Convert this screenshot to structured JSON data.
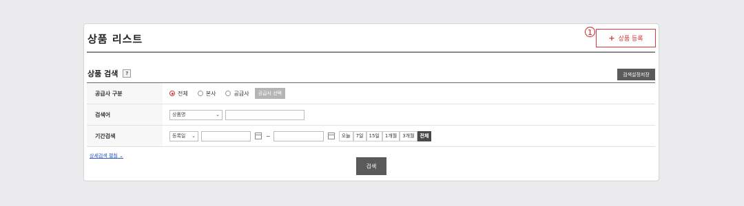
{
  "header": {
    "title": "상품 리스트",
    "step_marker": "1",
    "register_button": {
      "icon": "+",
      "label": "상품 등록"
    }
  },
  "search": {
    "title": "상품 검색",
    "help_icon": "?",
    "save_settings_label": "검색설정저장",
    "supplier_row": {
      "label": "공급사 구분",
      "options": [
        "전체",
        "본사",
        "공급사"
      ],
      "selected": "전체",
      "select_supplier_button": "공급사 선택"
    },
    "keyword_row": {
      "label": "검색어",
      "field_select": "상품명",
      "keyword_value": ""
    },
    "period_row": {
      "label": "기간검색",
      "date_type": "등록일",
      "start_date": "",
      "tilde": "~",
      "end_date": "",
      "quick_periods": [
        "오늘",
        "7일",
        "15일",
        "1개월",
        "3개월",
        "전체"
      ],
      "active_period": "전체"
    },
    "advanced_link": "상세검색 펼침",
    "search_button": "검색"
  },
  "colors": {
    "accent": "#d43a3a",
    "dark_button": "#5a5a5a"
  }
}
